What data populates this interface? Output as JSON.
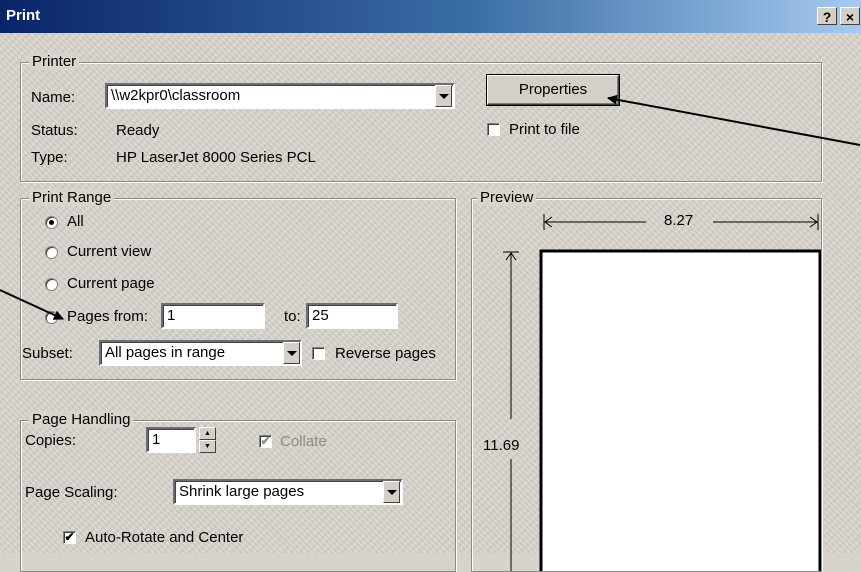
{
  "window": {
    "title": "Print",
    "help_glyph": "?",
    "close_glyph": "×"
  },
  "printer": {
    "group_label": "Printer",
    "name_label": "Name:",
    "name_value": "\\\\w2kpr0\\classroom",
    "status_label": "Status:",
    "status_value": "Ready",
    "type_label": "Type:",
    "type_value": "HP LaserJet 8000 Series PCL",
    "properties_button": "Properties",
    "print_to_file_label": "Print to file",
    "print_to_file_checked": false
  },
  "print_range": {
    "group_label": "Print Range",
    "options": [
      "All",
      "Current view",
      "Current page",
      "Pages from:"
    ],
    "selected": "All",
    "from_value": "1",
    "to_label": "to:",
    "to_value": "25",
    "subset_label": "Subset:",
    "subset_value": "All pages in range",
    "reverse_label": "Reverse pages",
    "reverse_checked": false
  },
  "page_handling": {
    "group_label": "Page Handling",
    "copies_label": "Copies:",
    "copies_value": "1",
    "collate_label": "Collate",
    "collate_checked": true,
    "scaling_label": "Page Scaling:",
    "scaling_value": "Shrink large pages",
    "autorotate_label": "Auto-Rotate and Center",
    "autorotate_checked": true
  },
  "preview": {
    "group_label": "Preview",
    "width_label": "8.27",
    "height_label": "11.69"
  },
  "icons": {
    "checkmark": "✔",
    "spin_up": "▲",
    "spin_down": "▼"
  },
  "colors": {
    "titlebar_start": "#0a246a",
    "titlebar_end": "#a6caf0",
    "face": "#d4d0c8"
  }
}
